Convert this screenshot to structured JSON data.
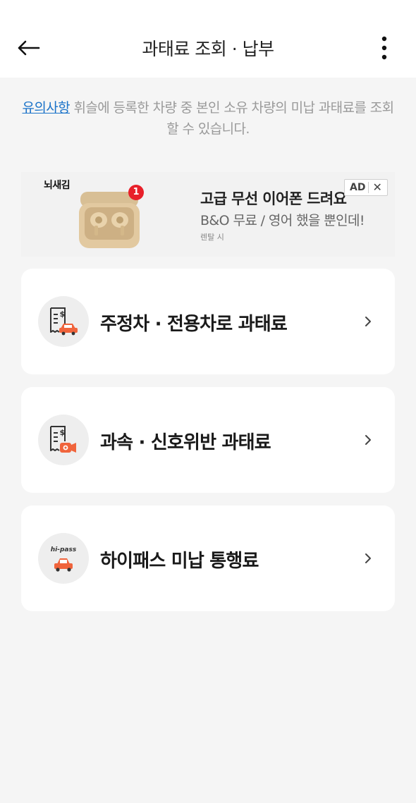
{
  "header": {
    "title": "과태료 조회 · 납부",
    "back_icon": "arrow-left-icon",
    "more_icon": "more-vertical-icon"
  },
  "notice": {
    "link_text": "유의사항",
    "text": " 휘슬에 등록한 차량 중 본인 소유 차량의 미납 과태료를 조회할 수 있습니다."
  },
  "ad": {
    "brand": "뇌새김",
    "badge_count": "1",
    "title": "고급 무선 이어폰 드려요",
    "description": "B&O 무료 / 영어 했을 뿐인데!",
    "sub": "렌탈 시",
    "tag": "AD",
    "close": "✕"
  },
  "menu": {
    "items": [
      {
        "label": "주정차 · 전용차로 과태료",
        "icon": "parking-fine-icon"
      },
      {
        "label": "과속 · 신호위반 과태료",
        "icon": "speed-camera-fine-icon"
      },
      {
        "label": "하이패스 미납 통행료",
        "icon": "hipass-toll-icon",
        "icon_text": "hi-pass"
      }
    ]
  },
  "colors": {
    "accent_link": "#1b73c9",
    "car_orange": "#f0643c",
    "background": "#f5f5f5"
  }
}
